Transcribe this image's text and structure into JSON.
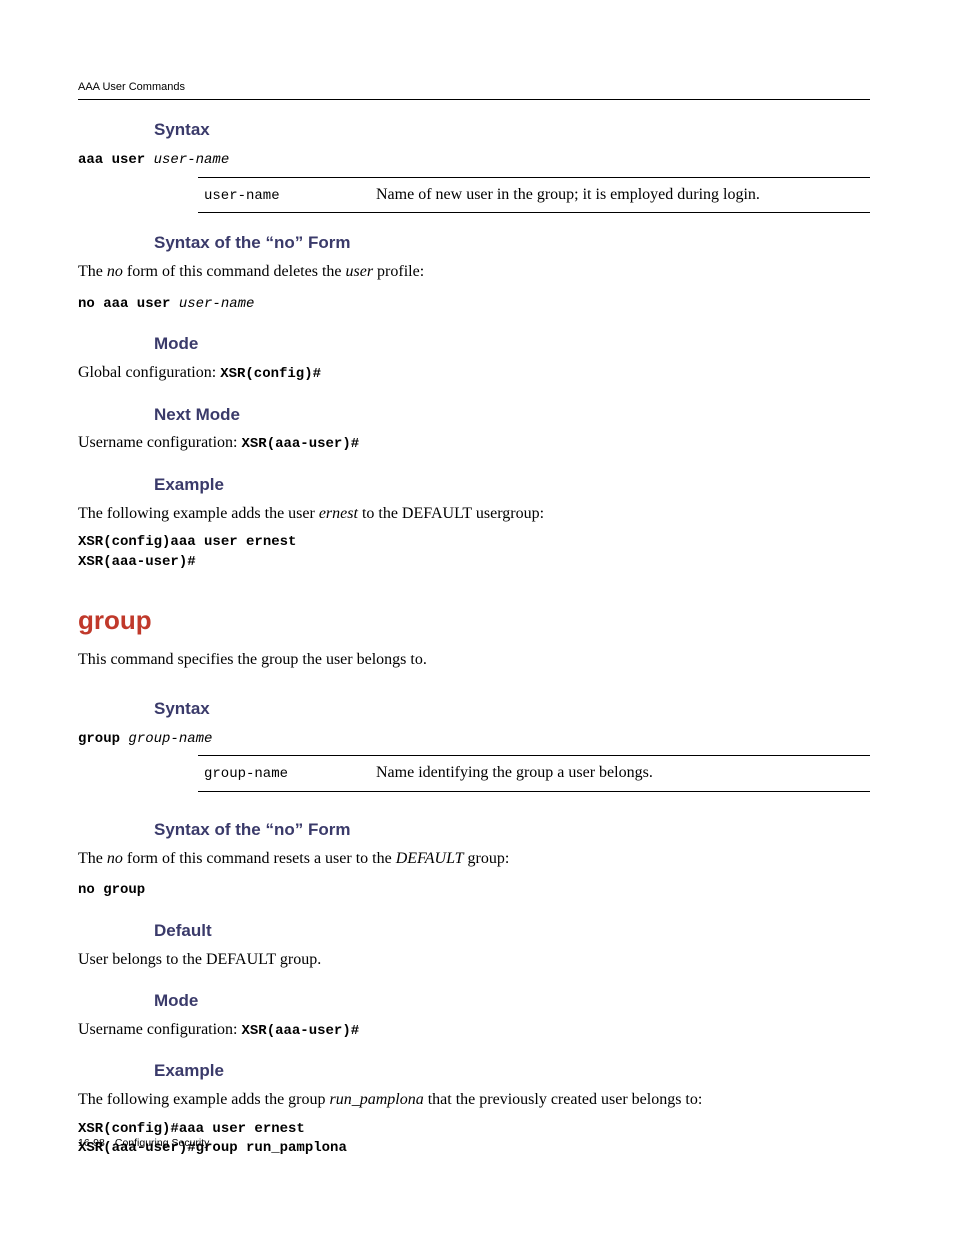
{
  "header": {
    "running": "AAA User Commands"
  },
  "s1": {
    "h_syntax": "Syntax",
    "syn_cmd_b": "aaa user ",
    "syn_cmd_i": "user-name",
    "tbl_param": "user-name",
    "tbl_desc": "Name of new user in the group; it is employed during login.",
    "h_noform": "Syntax of the “no” Form",
    "no_p1": "The ",
    "no_p2": "no",
    "no_p3": " form of this command deletes the ",
    "no_p4": "user",
    "no_p5": " profile:",
    "no_cmd_b": "no aaa user ",
    "no_cmd_i": "user-name",
    "h_mode": "Mode",
    "mode_t": "Global configuration: ",
    "mode_c": "XSR(config)#",
    "h_next": "Next Mode",
    "next_t": "Username configuration: ",
    "next_c": "XSR(aaa-user)#",
    "h_ex": "Example",
    "ex_p1": "The following example adds the user ",
    "ex_p2": "ernest",
    "ex_p3": " to the DEFAULT usergroup:",
    "ex_l1": "XSR(config)aaa user ernest",
    "ex_l2": "XSR(aaa-user)#"
  },
  "s2": {
    "h_main": "group",
    "desc": "This command specifies the group the user belongs to.",
    "h_syntax": "Syntax",
    "syn_cmd_b": "group ",
    "syn_cmd_i": "group-name",
    "tbl_param": "group-name",
    "tbl_desc": "Name identifying the group a user belongs.",
    "h_noform": "Syntax of the “no” Form",
    "no_p1": "The ",
    "no_p2": "no",
    "no_p3": " form of this command resets a user to the ",
    "no_p4": "DEFAULT",
    "no_p5": " group:",
    "no_cmd": "no group",
    "h_default": "Default",
    "default_t": "User belongs to the DEFAULT group.",
    "h_mode": "Mode",
    "mode_t": "Username configuration: ",
    "mode_c": "XSR(aaa-user)#",
    "h_ex": "Example",
    "ex_p1": "The following example adds the group ",
    "ex_p2": "run_pamplona",
    "ex_p3": " that the previously created user belongs to:",
    "ex_l1": "XSR(config)#aaa user ernest",
    "ex_l2": "XSR(aaa-user)#group run_pamplona"
  },
  "footer": {
    "pagenum": "16-98",
    "title": "Configuring Security"
  }
}
